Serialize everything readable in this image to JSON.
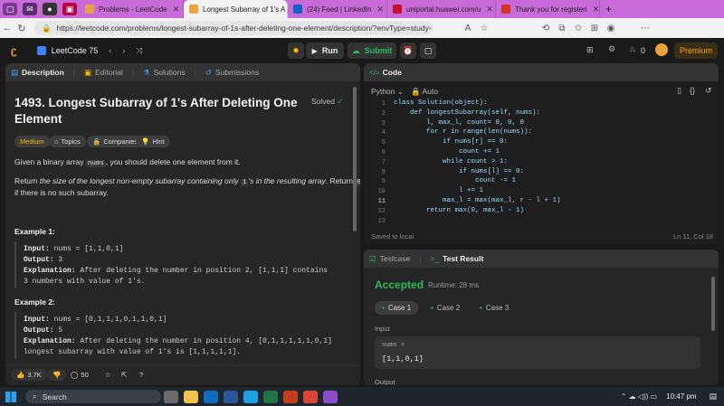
{
  "browser": {
    "tabs": [
      {
        "label": "Problems - LeetCode",
        "active": false,
        "color": "#e9a23b"
      },
      {
        "label": "Longest Subarray of 1's A",
        "active": true,
        "color": "#f0a23b"
      },
      {
        "label": "(24) Feed | LinkedIn",
        "active": false,
        "color": "#0a66c2"
      },
      {
        "label": "uniportal.huawei.com/u",
        "active": false,
        "color": "#c8102e"
      },
      {
        "label": "Thank you for registeri",
        "active": false,
        "color": "#d93025"
      }
    ],
    "url": "https://leetcode.com/problems/longest-subarray-of-1s-after-deleting-one-element/description/?envType=study-..."
  },
  "header": {
    "brand": "LeetCode 75",
    "run_label": "Run",
    "submit_label": "Submit",
    "streak": "0",
    "premium_label": "Premium"
  },
  "left": {
    "tabs": [
      "Description",
      "Editorial",
      "Solutions",
      "Submissions"
    ],
    "title_line1": "1493. Longest Subarray of 1's After Deleting One",
    "title_line2": "Element",
    "solved": "Solved",
    "tags": {
      "difficulty": "Medium",
      "topics": "Topics",
      "companies": "Companies",
      "hint": "Hint"
    },
    "desc1_pre": "Given a binary array ",
    "desc1_code": "nums",
    "desc1_post": ", you should delete one element from it.",
    "desc2_pre": "Return ",
    "desc2_em": "the size of the longest non-empty subarray containing only ",
    "desc2_code1": "1",
    "desc2_em2": "'s in the resulting array",
    "desc2_mid": ". Return ",
    "desc2_code2": "0",
    "desc2_line2": "if there is no such subarray.",
    "ex1": {
      "title": "Example 1:",
      "input_label": "Input:",
      "input": "nums = [1,1,0,1]",
      "output_label": "Output:",
      "output": "3",
      "expl_label": "Explanation:",
      "expl1": "After deleting the number in position 2, [1,1,1] contains",
      "expl2": "3 numbers with value of 1's."
    },
    "ex2": {
      "title": "Example 2:",
      "input_label": "Input:",
      "input": "nums = [0,1,1,1,0,1,1,0,1]",
      "output_label": "Output:",
      "output": "5",
      "expl_label": "Explanation:",
      "expl1": "After deleting the number in position 4, [0,1,1,1,1,1,0,1]",
      "expl2": "longest subarray with value of 1's is [1,1,1,1,1]."
    },
    "footer": {
      "likes": "3.7K",
      "comments": "50"
    }
  },
  "editor": {
    "tab": "Code",
    "language": "Python",
    "mode": "Auto",
    "lines": [
      "class Solution(object):",
      "    def longestSubarray(self, nums):",
      "        l, max_l, count= 0, 0, 0",
      "        for r in range(len(nums)):",
      "            if nums[r] == 0:",
      "                count += 1",
      "            while count > 1:",
      "                if nums[l] == 0:",
      "                    count -= 1",
      "                l += 1",
      "            max_l = max(max_l, r - l + 1)",
      "        return max(0, max_l - 1)",
      ""
    ],
    "line_numbers": [
      "1",
      "2",
      "3",
      "4",
      "5",
      "6",
      "7",
      "8",
      "9",
      "10",
      "11",
      "12",
      "13"
    ],
    "status_left": "Saved to local",
    "status_right": "Ln 11, Col 18"
  },
  "result": {
    "tabs": [
      "Testcase",
      "Test Result"
    ],
    "verdict": "Accepted",
    "runtime": "Runtime: 28 ms",
    "cases": [
      "Case 1",
      "Case 2",
      "Case 3"
    ],
    "input_label": "Input",
    "var_name": "nums =",
    "var_value": "[1,1,0,1]",
    "output_label": "Output"
  },
  "taskbar": {
    "search": "Search",
    "time": "10:47 pm"
  },
  "colors": {
    "accent": "#2cbb5d",
    "medium": "#ffb800",
    "premium": "#ffa116"
  }
}
